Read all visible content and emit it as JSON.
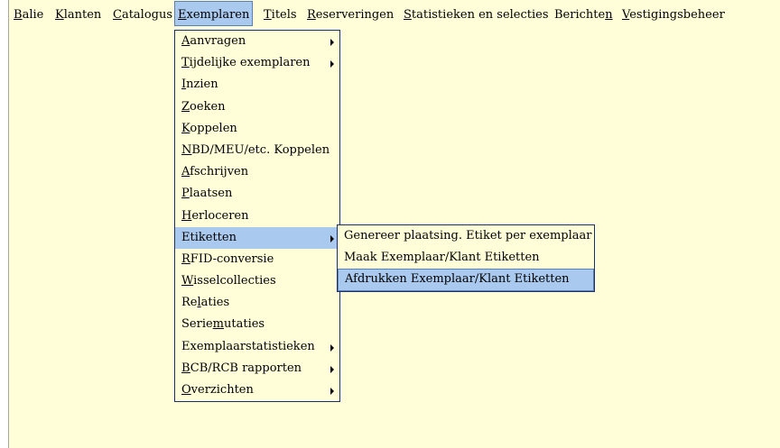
{
  "menubar": {
    "items": [
      {
        "label": "Balie",
        "mnemonic": "B",
        "rest": "alie"
      },
      {
        "label": "Klanten",
        "mnemonic": "K",
        "rest": "lanten"
      },
      {
        "label": "Catalogus",
        "mnemonic": "C",
        "rest": "atalogus"
      },
      {
        "label": "Exemplaren",
        "mnemonic": "E",
        "rest": "xemplaren"
      },
      {
        "label": "Titels",
        "mnemonic": "T",
        "rest": "itels"
      },
      {
        "label": "Reserveringen",
        "mnemonic": "R",
        "rest": "eserveringen"
      },
      {
        "label": "Statistieken en selecties",
        "mnemonic": "S",
        "rest": "tatistieken en selecties"
      },
      {
        "label": "Berichten",
        "pre": "Berichte",
        "mnemonic": "n"
      },
      {
        "label": "Vestigingsbeheer",
        "mnemonic": "V",
        "rest": "estigingsbeheer"
      }
    ]
  },
  "dropdown": {
    "items": [
      {
        "pre": "",
        "mnemonic": "A",
        "rest": "anvragen"
      },
      {
        "pre": "",
        "mnemonic": "T",
        "rest": "ijdelijke exemplaren"
      },
      {
        "pre": "",
        "mnemonic": "I",
        "rest": "nzien"
      },
      {
        "pre": "",
        "mnemonic": "Z",
        "rest": "oeken"
      },
      {
        "pre": "",
        "mnemonic": "K",
        "rest": "oppelen"
      },
      {
        "pre": "",
        "mnemonic": "N",
        "rest": "BD/MEU/etc. Koppelen"
      },
      {
        "pre": "",
        "mnemonic": "A",
        "rest": "fschrijven"
      },
      {
        "pre": "",
        "mnemonic": "P",
        "rest": "laatsen"
      },
      {
        "pre": "",
        "mnemonic": "H",
        "rest": "erloceren"
      },
      {
        "pre": "",
        "mnemonic": "",
        "rest": "Etiketten"
      },
      {
        "pre": "",
        "mnemonic": "R",
        "rest": "FID-conversie"
      },
      {
        "pre": "",
        "mnemonic": "W",
        "rest": "isselcollecties"
      },
      {
        "pre": "Re",
        "mnemonic": "l",
        "rest": "aties"
      },
      {
        "pre": "Serie",
        "mnemonic": "m",
        "rest": "utaties"
      },
      {
        "pre": "",
        "mnemonic": "",
        "rest": "Exemplaarstatistieken"
      },
      {
        "pre": "",
        "mnemonic": "B",
        "rest": "CB/RCB rapporten"
      },
      {
        "pre": "",
        "mnemonic": "O",
        "rest": "verzichten"
      }
    ]
  },
  "submenu": {
    "items": [
      {
        "label": "Genereer plaatsing. Etiket per exemplaar"
      },
      {
        "label": "Maak Exemplaar/Klant Etiketten"
      },
      {
        "label": "Afdrukken Exemplaar/Klant Etiketten"
      }
    ]
  }
}
